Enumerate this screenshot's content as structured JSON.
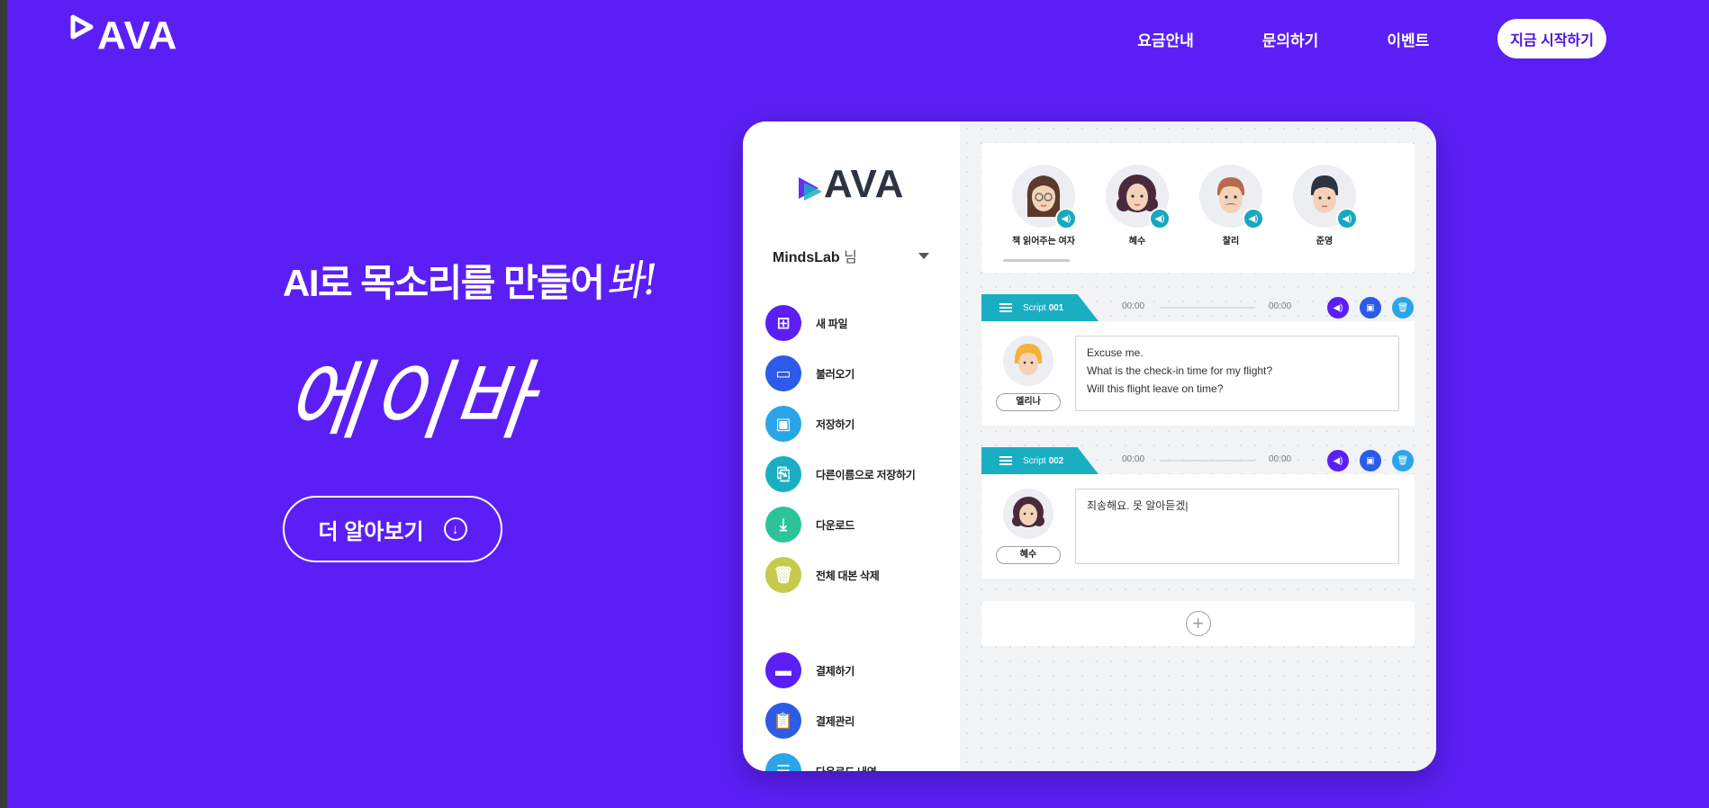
{
  "header": {
    "logo_text": "AVA",
    "nav": [
      "요금안내",
      "문의하기",
      "이벤트"
    ],
    "start_button": "지금 시작하기"
  },
  "hero": {
    "title": "AI로 목소리를 만들어",
    "title_hand": "봐!",
    "big": "에이바",
    "more_button": "더 알아보기"
  },
  "app": {
    "logo_text": "AVA",
    "user_name": "MindsLab",
    "user_suffix": "님",
    "menu_top": [
      {
        "label": "새 파일",
        "icon": "plus-square-icon",
        "color": "#5b1ff5"
      },
      {
        "label": "불러오기",
        "icon": "folder-icon",
        "color": "#2b5be8"
      },
      {
        "label": "저장하기",
        "icon": "save-icon",
        "color": "#2aa6e8"
      },
      {
        "label": "다른이름으로 저장하기",
        "icon": "save-as-icon",
        "color": "#1aaec3"
      },
      {
        "label": "다운로드",
        "icon": "download-icon",
        "color": "#2bc49a"
      },
      {
        "label": "전체 대본 삭제",
        "icon": "trash-icon",
        "color": "#c6c94a"
      }
    ],
    "menu_bottom": [
      {
        "label": "결제하기",
        "icon": "card-icon",
        "color": "#5b1ff5"
      },
      {
        "label": "결제관리",
        "icon": "clipboard-icon",
        "color": "#2b5be8"
      },
      {
        "label": "다운로드 내역",
        "icon": "list-icon",
        "color": "#2aa6e8"
      }
    ],
    "voices": [
      "책 읽어주는 여자",
      "혜수",
      "찰리",
      "준영"
    ],
    "scripts": [
      {
        "label_prefix": "Script",
        "label_num": "001",
        "time_start": "00:00",
        "time_end": "00:00",
        "speaker": "엘리나",
        "lines": [
          "Excuse me.",
          "What is the check-in time for my flight?",
          "Will this flight leave on time?"
        ]
      },
      {
        "label_prefix": "Script",
        "label_num": "002",
        "time_start": "00:00",
        "time_end": "00:00",
        "speaker": "혜수",
        "lines": [
          "죄송해요. 못 알아듣겠|"
        ]
      }
    ]
  },
  "colors": {
    "background": "#5b1ff5",
    "accent_teal": "#1aaec3",
    "accent_purple": "#5b1ff5",
    "accent_blue": "#2b5be8"
  }
}
